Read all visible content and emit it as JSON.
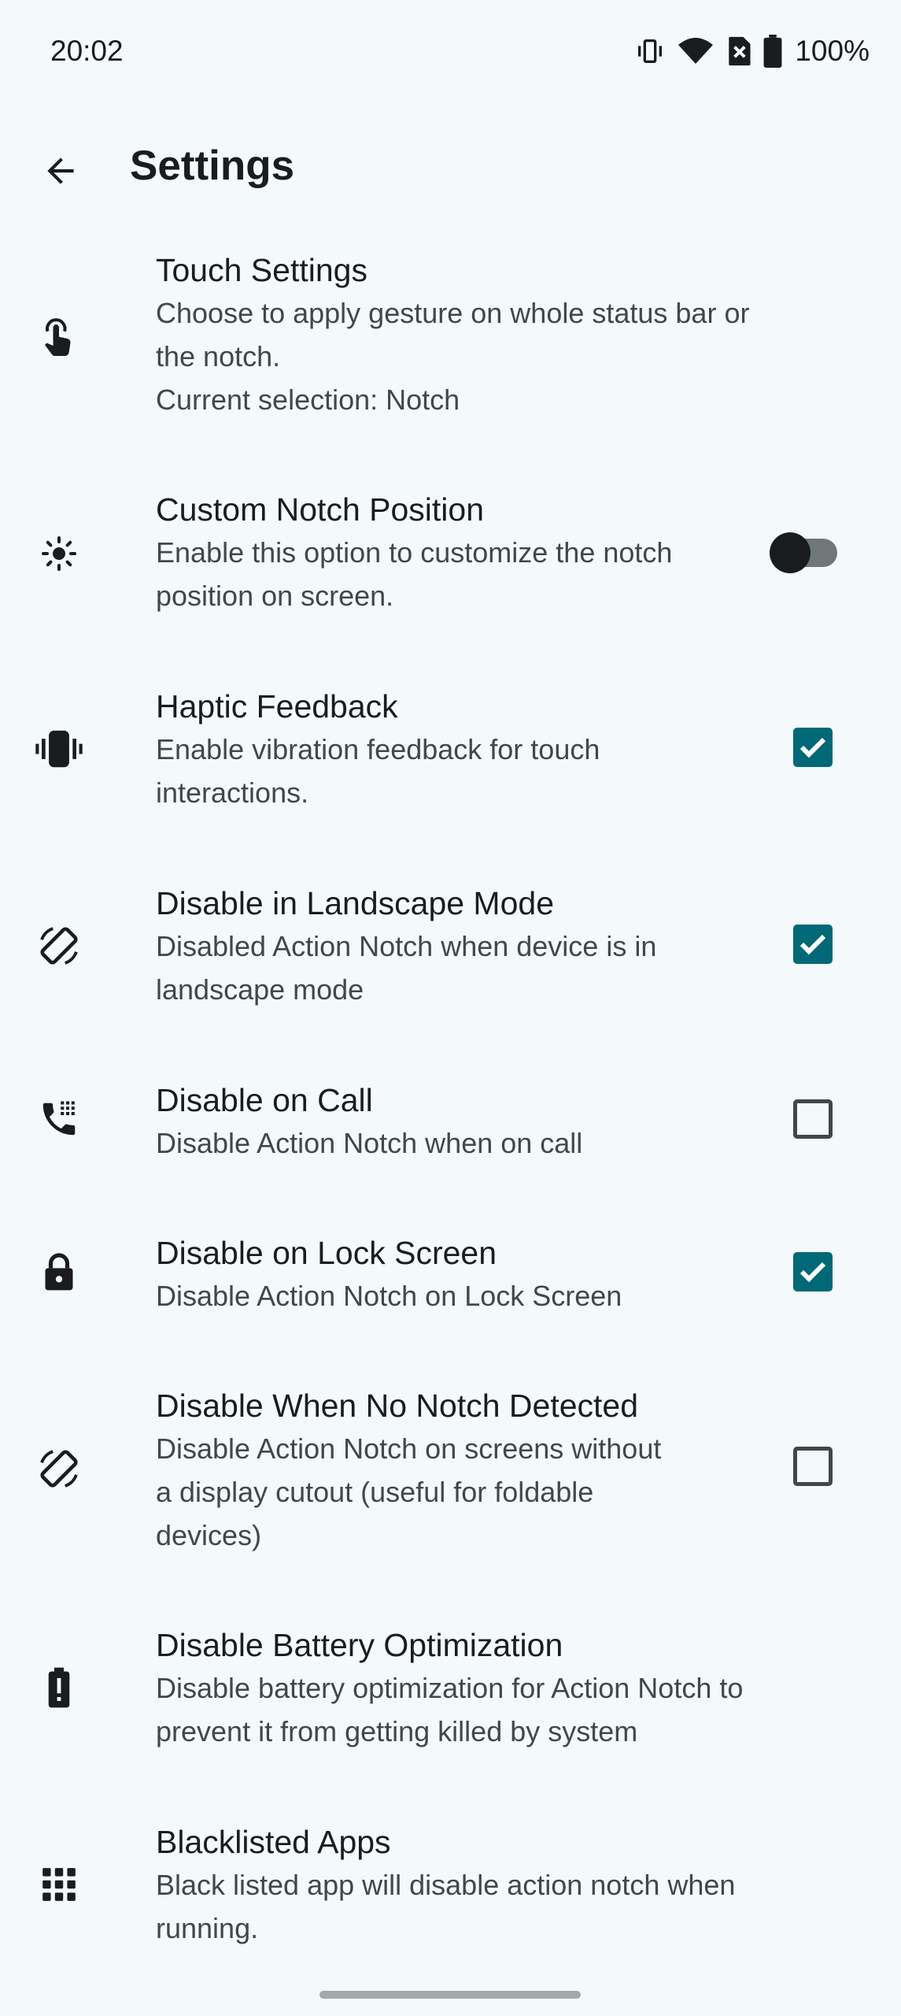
{
  "status_bar": {
    "time": "20:02",
    "battery": "100%",
    "icons": [
      "vibrate-icon",
      "wifi-icon",
      "no-sim-icon",
      "battery-icon"
    ]
  },
  "app_bar": {
    "title": "Settings",
    "back_icon": "arrow-back-icon"
  },
  "colors": {
    "accent": "#006876",
    "background": "#f4fafb",
    "text_primary": "#1b1c1d",
    "text_secondary": "#3f484a"
  },
  "settings": [
    {
      "icon": "touch-app-icon",
      "title": "Touch Settings",
      "summary": [
        "Choose to apply gesture on whole status bar or",
        "the notch.",
        "Current selection: Notch"
      ],
      "control": "none"
    },
    {
      "icon": "brightness-icon",
      "title": "Custom Notch Position",
      "summary": [
        "Enable this option to customize the notch",
        "position on screen."
      ],
      "control": "switch",
      "checked": false
    },
    {
      "icon": "vibration-icon",
      "title": "Haptic Feedback",
      "summary": [
        "Enable vibration feedback for touch",
        "interactions."
      ],
      "control": "checkbox",
      "checked": true
    },
    {
      "icon": "screen-rotation-icon",
      "title": "Disable in Landscape Mode",
      "summary": [
        "Disabled Action Notch when device is in",
        "landscape mode"
      ],
      "control": "checkbox",
      "checked": true
    },
    {
      "icon": "dialpad-call-icon",
      "title": "Disable on Call",
      "summary": [
        "Disable Action Notch when on call"
      ],
      "control": "checkbox",
      "checked": false
    },
    {
      "icon": "lock-icon",
      "title": "Disable on Lock Screen",
      "summary": [
        "Disable Action Notch on Lock Screen"
      ],
      "control": "checkbox",
      "checked": true
    },
    {
      "icon": "screen-rotation-icon",
      "title": "Disable When No Notch Detected",
      "summary": [
        "Disable Action Notch on screens without",
        "a display cutout (useful for foldable",
        "devices)"
      ],
      "control": "checkbox",
      "checked": false
    },
    {
      "icon": "battery-alert-icon",
      "title": "Disable Battery Optimization",
      "summary": [
        "Disable battery optimization for Action Notch to",
        "prevent it from getting killed by system"
      ],
      "control": "none"
    },
    {
      "icon": "apps-grid-icon",
      "title": "Blacklisted Apps",
      "summary": [
        "Black listed app will disable action notch when",
        "running."
      ],
      "control": "none"
    }
  ]
}
